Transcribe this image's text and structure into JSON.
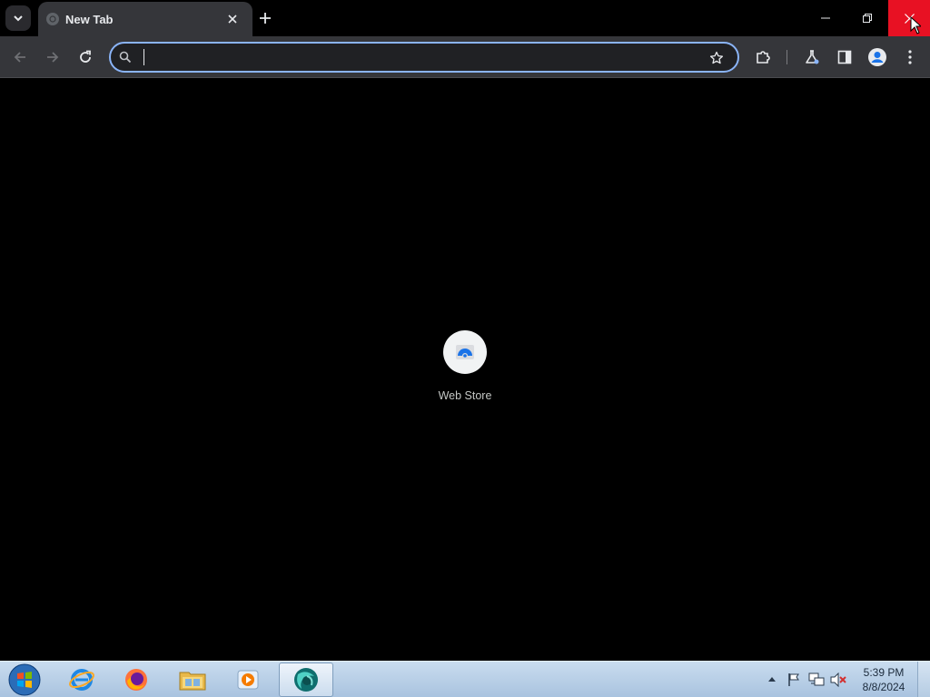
{
  "browser": {
    "tab": {
      "title": "New Tab"
    },
    "omnibox": {
      "value": "",
      "placeholder": ""
    },
    "colors": {
      "tab_bg": "#35363a",
      "accent": "#8ab4f8",
      "close_hover": "#e81123"
    }
  },
  "new_tab_page": {
    "shortcuts": [
      {
        "label": "Web Store",
        "icon": "web-store-icon"
      }
    ]
  },
  "taskbar": {
    "apps": [
      {
        "name": "internet-explorer",
        "icon": "ie-icon"
      },
      {
        "name": "firefox",
        "icon": "firefox-icon"
      },
      {
        "name": "file-explorer",
        "icon": "folder-icon"
      },
      {
        "name": "media-player",
        "icon": "media-player-icon"
      },
      {
        "name": "browser",
        "icon": "browser-icon",
        "active": true
      }
    ],
    "clock": {
      "time": "5:39 PM",
      "date": "8/8/2024"
    }
  }
}
